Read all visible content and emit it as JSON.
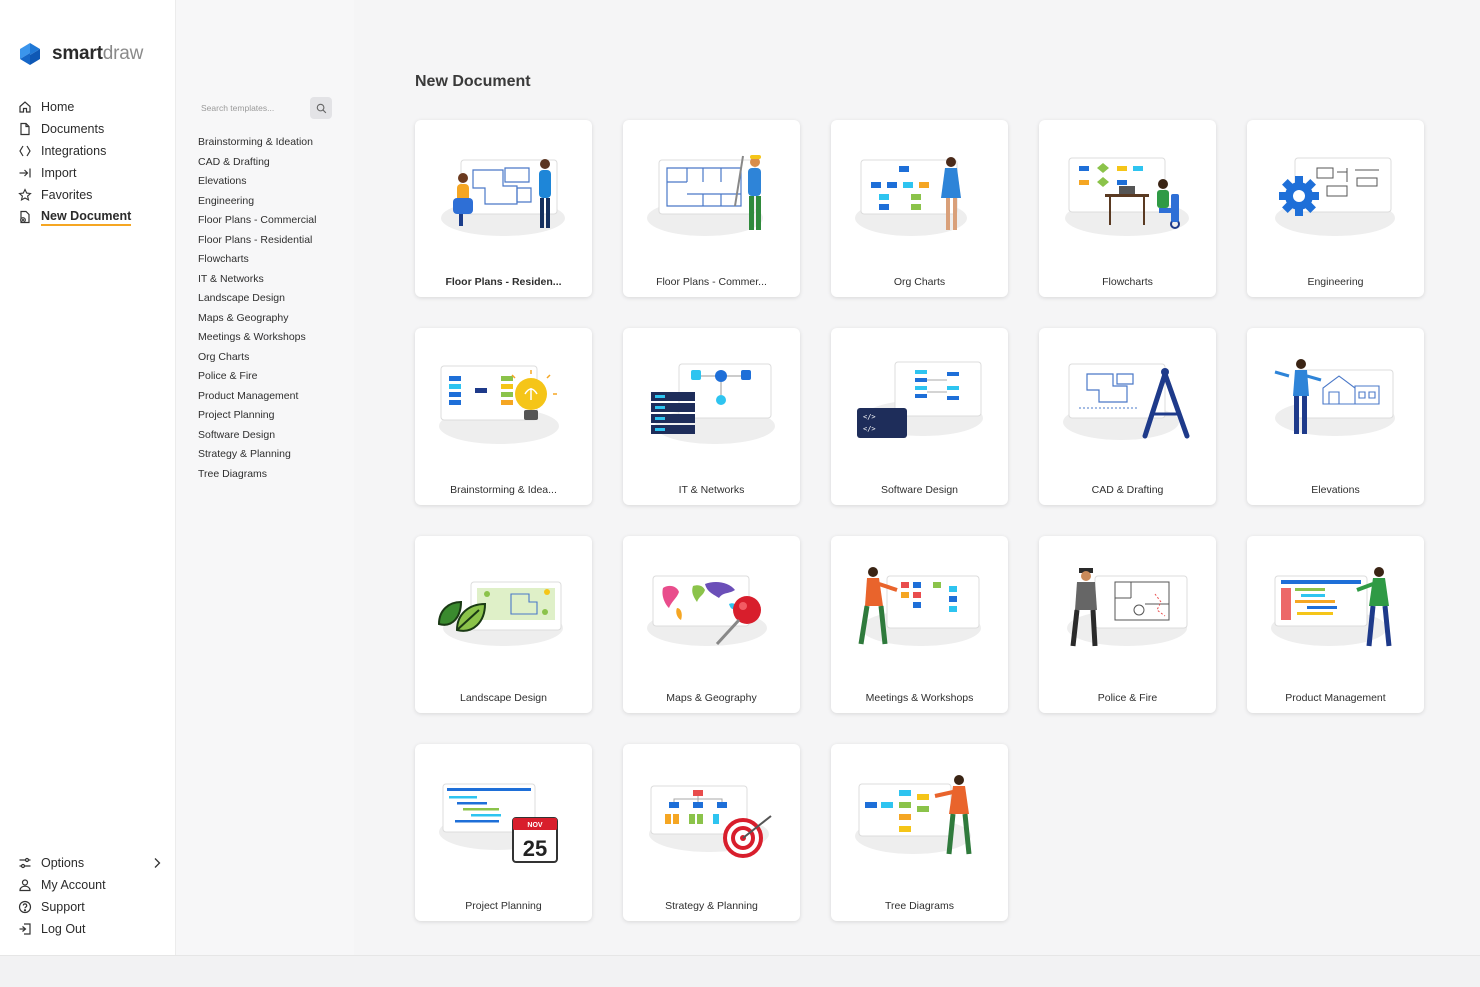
{
  "brand": {
    "name_bold": "smart",
    "name_light": "draw"
  },
  "nav": {
    "items": [
      {
        "label": "Home",
        "icon": "home-icon"
      },
      {
        "label": "Documents",
        "icon": "document-icon"
      },
      {
        "label": "Integrations",
        "icon": "integrations-icon"
      },
      {
        "label": "Import",
        "icon": "import-icon"
      },
      {
        "label": "Favorites",
        "icon": "star-icon"
      },
      {
        "label": "New Document",
        "icon": "new-document-icon",
        "active": true
      }
    ],
    "bottom": [
      {
        "label": "Options",
        "icon": "sliders-icon"
      },
      {
        "label": "My Account",
        "icon": "user-icon"
      },
      {
        "label": "Support",
        "icon": "help-icon"
      },
      {
        "label": "Log Out",
        "icon": "logout-icon"
      }
    ]
  },
  "search": {
    "placeholder": "Search templates..."
  },
  "categories": [
    "Brainstorming & Ideation",
    "CAD & Drafting",
    "Elevations",
    "Engineering",
    "Floor Plans - Commercial",
    "Floor Plans - Residential",
    "Flowcharts",
    "IT & Networks",
    "Landscape Design",
    "Maps & Geography",
    "Meetings & Workshops",
    "Org Charts",
    "Police & Fire",
    "Product Management",
    "Project Planning",
    "Software Design",
    "Strategy & Planning",
    "Tree Diagrams"
  ],
  "main": {
    "title": "New Document",
    "cards": [
      "Floor Plans - Residen...",
      "Floor Plans - Commer...",
      "Org Charts",
      "Flowcharts",
      "Engineering",
      "Brainstorming & Idea...",
      "IT & Networks",
      "Software Design",
      "CAD & Drafting",
      "Elevations",
      "Landscape Design",
      "Maps & Geography",
      "Meetings & Workshops",
      "Police & Fire",
      "Product Management",
      "Project Planning",
      "Strategy & Planning",
      "Tree Diagrams"
    ],
    "calendar": {
      "month": "NOV",
      "day": "25"
    }
  },
  "colors": {
    "accent": "#f5a623",
    "brand_blue": "#1a73e8",
    "primary_blue": "#2173d8"
  }
}
